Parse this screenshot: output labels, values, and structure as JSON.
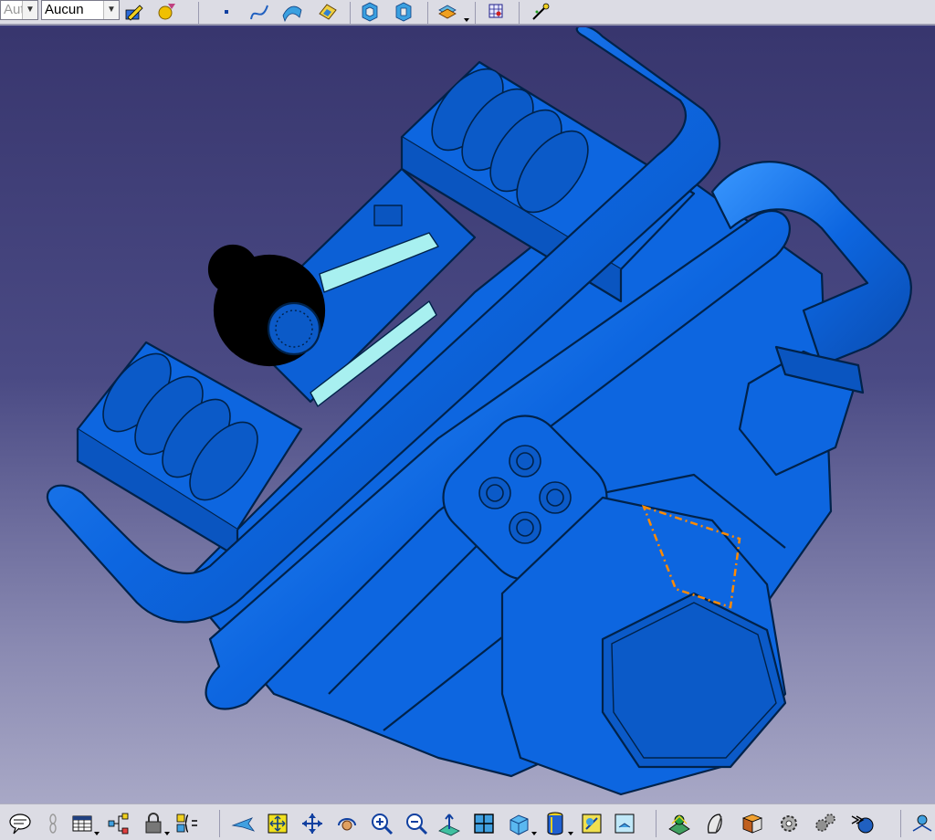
{
  "toolbar": {
    "combo1_value": "Aut",
    "combo2_value": "Aucun"
  },
  "icons": {
    "top": [
      "color-picker-icon",
      "material-icon",
      "point-icon",
      "curve-icon",
      "surface-icon",
      "fill-icon",
      "part-body-icon",
      "geometrical-set-icon",
      "insert-component-icon",
      "constraint-icon",
      "measure-icon"
    ],
    "bottom": [
      "speech-bubble-icon",
      "chain-icon",
      "table-icon",
      "tree-icon",
      "lock-icon",
      "formula-icon",
      "fly-mode-icon",
      "fit-all-icon",
      "pan-icon",
      "rotate-icon",
      "zoom-in-icon",
      "zoom-out-icon",
      "normal-view-icon",
      "multi-view-icon",
      "iso-view-icon",
      "shading-icon",
      "hide-show-icon",
      "swap-visible-icon",
      "catalog-icon",
      "tools-icon",
      "options-icon",
      "settings-icon",
      "gears-icon",
      "flyout-icon",
      "last-icon"
    ]
  },
  "colors": {
    "model_blue": "#0d66e0",
    "model_edge": "#00224a",
    "highlight_orange": "#ff8a00",
    "cyan_slot": "#a8f0f0",
    "bg_top": "#38366e",
    "bg_bottom": "#a8a8c6"
  }
}
